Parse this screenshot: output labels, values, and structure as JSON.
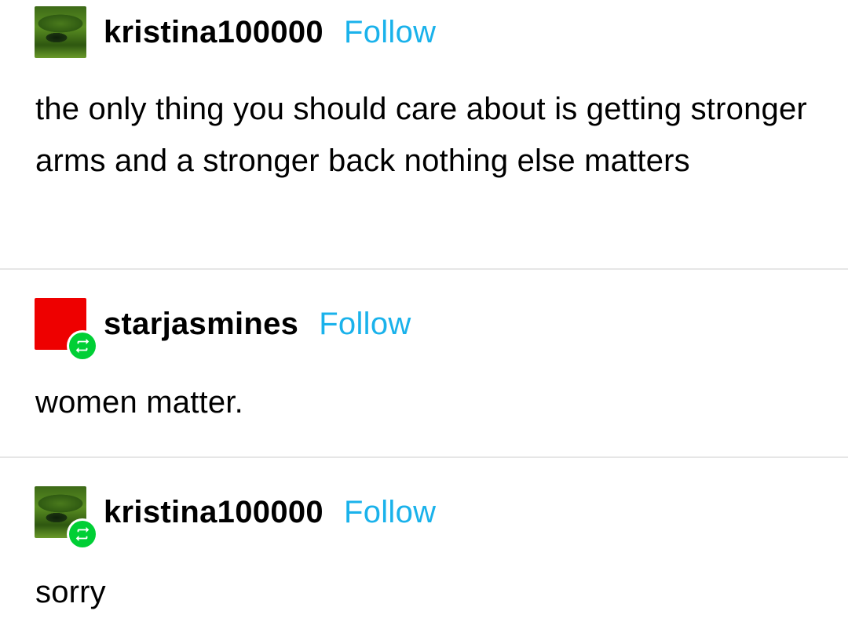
{
  "posts": [
    {
      "username": "kristina100000",
      "follow_label": "Follow",
      "avatar": "green-landscape-avatar",
      "reblogged": false,
      "text": "the only thing you should care about is getting stronger arms and a stronger back nothing else matters"
    },
    {
      "username": "starjasmines",
      "follow_label": "Follow",
      "avatar": "red-square-avatar",
      "reblogged": true,
      "text": "women matter."
    },
    {
      "username": "kristina100000",
      "follow_label": "Follow",
      "avatar": "green-landscape-avatar",
      "reblogged": true,
      "text": "sorry"
    }
  ],
  "colors": {
    "follow": "#1ab2eb",
    "reblog_badge": "#00cf35",
    "divider": "#e6e6e6",
    "red_avatar": "#ee0000"
  },
  "icons": {
    "reblog": "reblog-icon"
  }
}
